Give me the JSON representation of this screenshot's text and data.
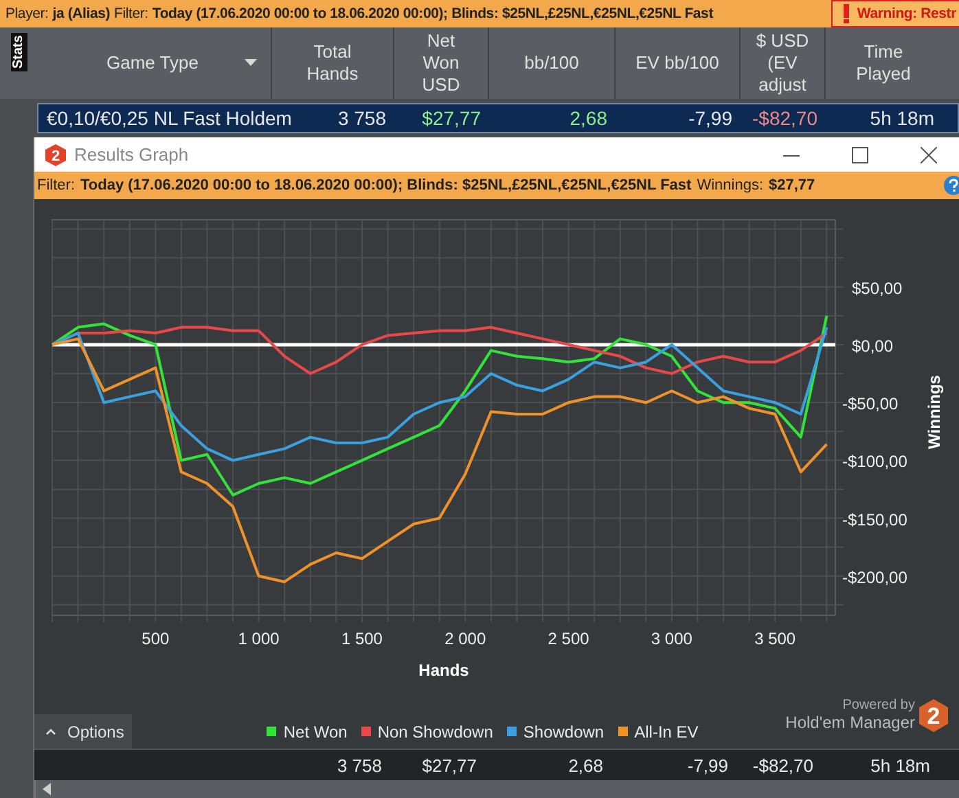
{
  "filter_bar": {
    "player_label": "Player:",
    "player": "ja (Alias)",
    "filter_label": "Filter:",
    "filter": "Today (17.06.2020 00:00 to 18.06.2020 00:00); Blinds: $25NL,£25NL,€25NL,€25NL Fast",
    "warning": "Warning: Restr"
  },
  "side_tab": {
    "label": "Stats"
  },
  "table": {
    "columns": [
      {
        "label": "Game Type",
        "sortable": true
      },
      {
        "label": "Total\nHands",
        "sortable": false
      },
      {
        "label": "Net\nWon\nUSD",
        "sortable": false
      },
      {
        "label": "bb/100",
        "sortable": false
      },
      {
        "label": "EV bb/100",
        "sortable": false
      },
      {
        "label": "$ USD\n(EV\nadjust",
        "sortable": false
      },
      {
        "label": "Time\nPlayed",
        "sortable": false
      }
    ],
    "rows": [
      {
        "selected": true,
        "cells": [
          {
            "text": "€0,10/€0,25 NL Fast Holdem"
          },
          {
            "text": "3 758"
          },
          {
            "text": "$27,77",
            "color": "#8ef08e"
          },
          {
            "text": "2,68",
            "color": "#8ef08e"
          },
          {
            "text": "-7,99"
          },
          {
            "text": "-$82,70",
            "color": "#f08888"
          },
          {
            "text": "5h 18m"
          }
        ]
      }
    ]
  },
  "graph_window": {
    "logo_mark": "2",
    "title": "Results Graph",
    "filter_label": "Filter:",
    "filter": "Today (17.06.2020 00:00 to 18.06.2020 00:00); Blinds: $25NL,£25NL,€25NL,€25NL Fast",
    "winnings_label": "Winnings:",
    "winnings": "$27,77",
    "chart_data": {
      "type": "line",
      "grid": true,
      "xlabel": "Hands",
      "ylabel": "Winnings",
      "x": [
        0,
        125,
        250,
        375,
        500,
        625,
        750,
        875,
        1000,
        1125,
        1250,
        1375,
        1500,
        1625,
        1750,
        1875,
        2000,
        2125,
        2250,
        2375,
        2500,
        2625,
        2750,
        2875,
        3000,
        3125,
        3250,
        3375,
        3500,
        3625,
        3750
      ],
      "series": [
        {
          "name": "Net Won",
          "color": "#33e33a",
          "values": [
            0,
            15,
            18,
            8,
            0,
            -100,
            -95,
            -130,
            -120,
            -115,
            -120,
            -110,
            -100,
            -90,
            -80,
            -70,
            -40,
            -5,
            -10,
            -12,
            -15,
            -12,
            5,
            0,
            -10,
            -40,
            -50,
            -50,
            -55,
            -80,
            25
          ]
        },
        {
          "name": "Non Showdown",
          "color": "#e84848",
          "values": [
            0,
            10,
            10,
            12,
            10,
            15,
            15,
            12,
            12,
            -10,
            -25,
            -15,
            0,
            8,
            10,
            12,
            12,
            15,
            10,
            5,
            0,
            -5,
            -10,
            -20,
            -25,
            -15,
            -10,
            -15,
            -15,
            -5,
            10
          ]
        },
        {
          "name": "Showdown",
          "color": "#3aa0e0",
          "values": [
            0,
            10,
            -50,
            -45,
            -40,
            -70,
            -90,
            -100,
            -95,
            -90,
            -80,
            -85,
            -85,
            -80,
            -60,
            -50,
            -45,
            -25,
            -35,
            -40,
            -30,
            -15,
            -20,
            -15,
            0,
            -20,
            -40,
            -45,
            -50,
            -60,
            15
          ]
        },
        {
          "name": "All-In EV",
          "color": "#f0922a",
          "values": [
            0,
            5,
            -40,
            -30,
            -20,
            -110,
            -120,
            -140,
            -200,
            -205,
            -190,
            -180,
            -185,
            -170,
            -155,
            -150,
            -112,
            -58,
            -60,
            -60,
            -50,
            -45,
            -45,
            -50,
            -40,
            -50,
            -45,
            -55,
            -60,
            -110,
            -86
          ]
        }
      ],
      "xlim": [
        0,
        3792
      ],
      "ylim": [
        -234,
        108
      ],
      "xticks": [
        {
          "value": 500,
          "label": "500"
        },
        {
          "value": 1000,
          "label": "1 000"
        },
        {
          "value": 1500,
          "label": "1 500"
        },
        {
          "value": 2000,
          "label": "2 000"
        },
        {
          "value": 2500,
          "label": "2 500"
        },
        {
          "value": 3000,
          "label": "3 000"
        },
        {
          "value": 3500,
          "label": "3 500"
        }
      ],
      "yticks": [
        {
          "value": 50,
          "label": "$50,00"
        },
        {
          "value": 0,
          "label": "$0,00"
        },
        {
          "value": -50,
          "label": "-$50,00"
        },
        {
          "value": -100,
          "label": "-$100,00"
        },
        {
          "value": -150,
          "label": "-$150,00"
        },
        {
          "value": -200,
          "label": "-$200,00"
        }
      ]
    },
    "options_label": "Options",
    "powered_by": "Powered by",
    "brand": "Hold'em Manager",
    "brand_mark": "2",
    "totals": [
      "3 758",
      "$27,77",
      "2,68",
      "-7,99",
      "-$82,70",
      "5h 18m"
    ]
  }
}
